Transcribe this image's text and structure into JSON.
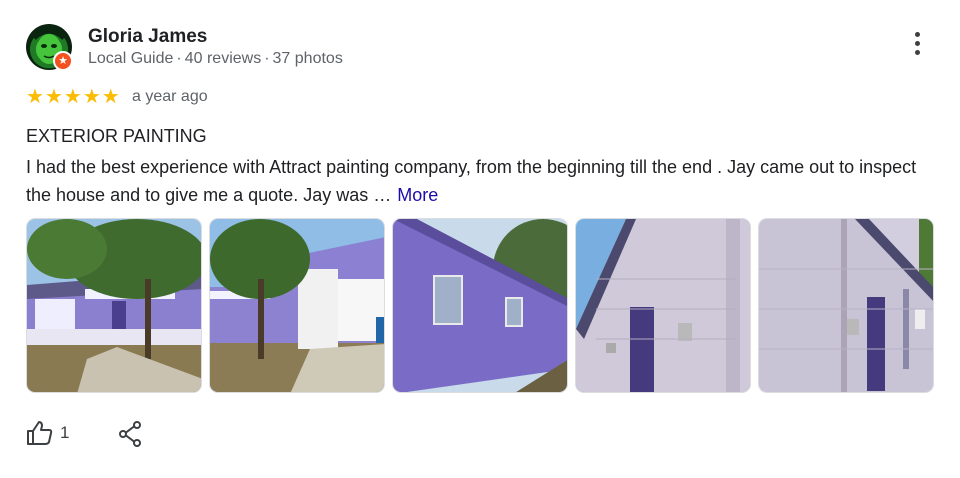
{
  "reviewer": {
    "name": "Gloria James",
    "badge": "Local Guide",
    "reviews": "40 reviews",
    "photos": "37 photos",
    "separator": "·"
  },
  "rating": {
    "stars": 5,
    "max": 5,
    "time": "a year ago",
    "star_color": "#fbbc04"
  },
  "review": {
    "title": "EXTERIOR PAINTING",
    "text": "I  had the best experience with Attract painting company, from the beginning till the end . Jay came out to inspect the house and to give me a quote. Jay was …",
    "more_label": "More",
    "link_color": "#1a0dab"
  },
  "actions": {
    "like_count": "1",
    "like_icon": "thumbs-up-icon",
    "share_icon": "share-icon",
    "menu_icon": "more-vert-icon"
  },
  "colors": {
    "house_purple": "#7e6fc2",
    "badge_orange": "#f4511e"
  }
}
